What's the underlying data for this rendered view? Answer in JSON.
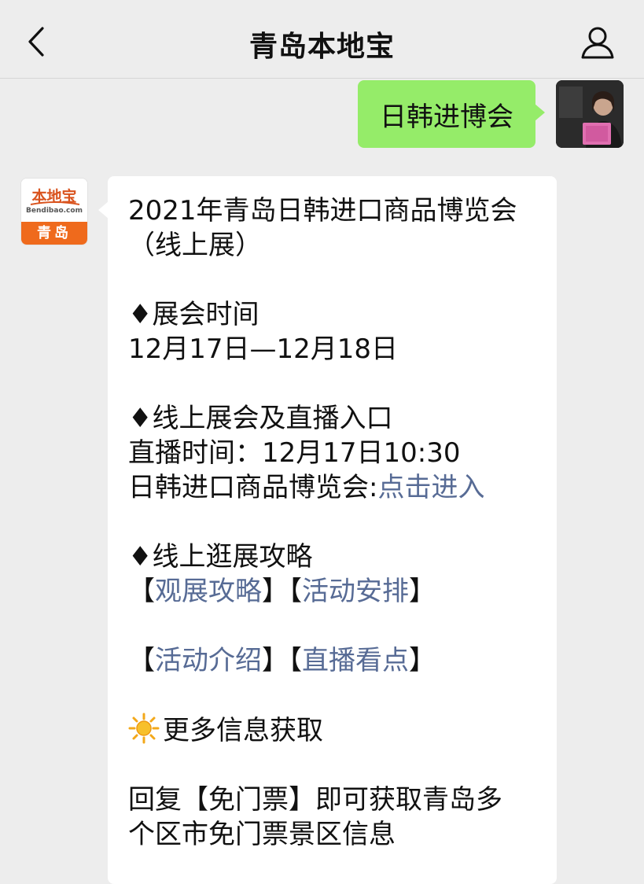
{
  "header": {
    "title": "青岛本地宝",
    "back_icon": "chevron-left-icon",
    "profile_icon": "person-icon"
  },
  "outgoing": {
    "text": "日韩进博会",
    "bubble_color": "#95ec69"
  },
  "bot": {
    "avatar_logo": "本地宝",
    "avatar_domain": "Bendibao.com",
    "avatar_city": "青岛",
    "accent_color": "#ef6a1c"
  },
  "message": {
    "title_line1": "2021年青岛日韩进口商品博览会",
    "title_line2": "（线上展）",
    "section1_heading": "♦展会时间",
    "section1_value": "12月17日—12月18日",
    "section2_heading": "♦线上展会及直播入口",
    "section2_time": "直播时间：12月17日10:30",
    "section2_entry_label": "日韩进口商品博览会:",
    "section2_entry_link": "点击进入",
    "section3_heading": "♦线上逛展攻略",
    "links_row1": [
      "观展攻略",
      "活动安排"
    ],
    "links_row2": [
      "活动介绍",
      "直播看点"
    ],
    "section4_heading": "更多信息获取",
    "reply_line1": "回复【免门票】即可获取青岛多",
    "reply_line2": "个区市免门票景区信息",
    "link_color": "#576b95"
  }
}
